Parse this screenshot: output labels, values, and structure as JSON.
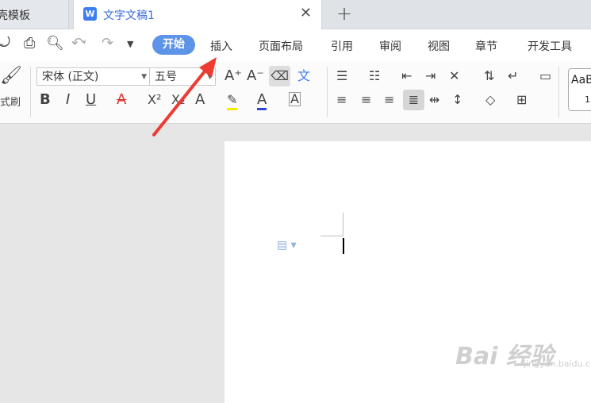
{
  "tabs": {
    "template_tab": "壳模板",
    "doc_tab_icon": "W",
    "doc_tab_title": "文字文稿1",
    "close": "✕",
    "new_tab": "+"
  },
  "menu": {
    "start": "开始",
    "insert": "插入",
    "page_layout": "页面布局",
    "reference": "引用",
    "review": "审阅",
    "view": "视图",
    "section": "章节",
    "developer": "开发工具"
  },
  "ribbon": {
    "format_painter": "式刷",
    "font_name": "宋体 (正文)",
    "font_size": "五号",
    "style_preview": "AaB",
    "style_preview_sub": "1"
  },
  "colors": {
    "accent": "#5e94e8",
    "arrow": "#ee3b32",
    "doc_title": "#3a6cd9"
  },
  "watermark": {
    "main": "Bai 经验",
    "sub": "jingyan.baidu.com"
  }
}
